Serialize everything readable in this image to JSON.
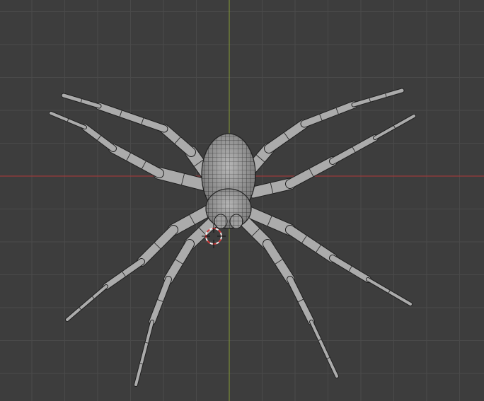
{
  "viewport": {
    "view": "top",
    "shading": "wireframe-overlay",
    "object": "spider-mesh",
    "colors": {
      "background": "#3d3d3d",
      "grid": "#4a4a4a",
      "x_axis": "#9a3b3b",
      "y_axis": "#7a8c3a",
      "mesh_fill": "#a9a9a9",
      "mesh_wire": "#1f1f1f",
      "cursor_red": "#d33b3b",
      "cursor_white": "#f0f0f0"
    }
  }
}
